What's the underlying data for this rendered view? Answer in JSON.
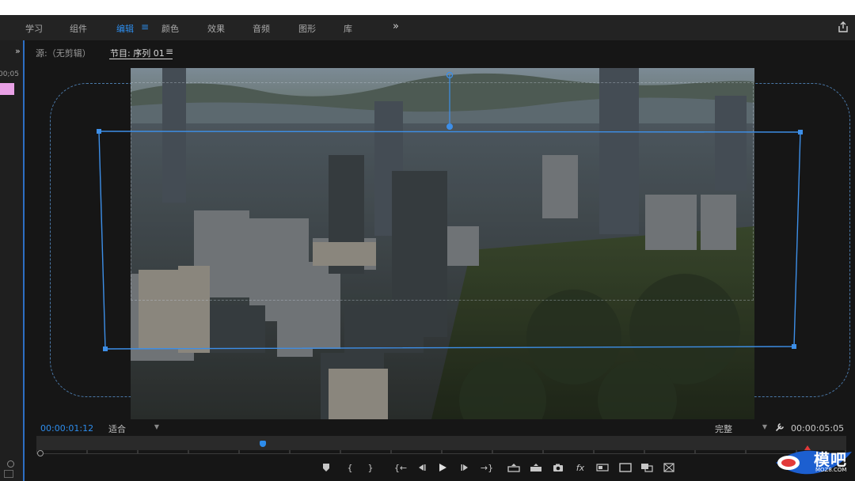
{
  "workspace": {
    "tabs": [
      {
        "label": "学习"
      },
      {
        "label": "组件"
      },
      {
        "label": "编辑"
      },
      {
        "label": "颜色"
      },
      {
        "label": "效果"
      },
      {
        "label": "音频"
      },
      {
        "label": "图形"
      },
      {
        "label": "库"
      }
    ],
    "active_tab": "编辑",
    "menu_glyph": "≡",
    "more_glyph": "»",
    "share_icon": "share-icon"
  },
  "left_panel": {
    "expand_glyph": "»",
    "timecode_fragment": "00;05",
    "clip_color": "#e9a1e6"
  },
  "monitor": {
    "source_tab": "源:（无剪辑）",
    "program_tab": "节目: 序列 01",
    "menu_glyph": "≡",
    "current_timecode": "00:00:01:12",
    "zoom_level": "适合",
    "playback_resolution": "完整",
    "duration_timecode": "00:00:05:05",
    "playhead_position_fraction": 0.28,
    "accent_color": "#2d8ceb"
  },
  "transport": {
    "buttons": [
      {
        "name": "add-marker",
        "icon": "marker-icon"
      },
      {
        "name": "mark-in",
        "glyph": "{"
      },
      {
        "name": "mark-out",
        "glyph": "}"
      },
      {
        "name": "go-to-in",
        "glyph": "{←"
      },
      {
        "name": "step-back",
        "icon": "step-back-icon"
      },
      {
        "name": "play",
        "icon": "play-icon"
      },
      {
        "name": "step-forward",
        "icon": "step-forward-icon"
      },
      {
        "name": "go-to-out",
        "glyph": "→}"
      },
      {
        "name": "lift",
        "icon": "lift-icon"
      },
      {
        "name": "extract",
        "icon": "extract-icon"
      },
      {
        "name": "export-frame",
        "icon": "camera-icon"
      },
      {
        "name": "effects",
        "glyph": "fx"
      },
      {
        "name": "comparison-view",
        "icon": "comparison-icon"
      },
      {
        "name": "safe-margins",
        "icon": "safe-margins-icon"
      },
      {
        "name": "overlays",
        "icon": "overlays-icon"
      },
      {
        "name": "proxy-toggle",
        "icon": "proxy-icon"
      }
    ]
  },
  "watermark": {
    "text": "模吧",
    "url": "MOZ8.COM"
  }
}
